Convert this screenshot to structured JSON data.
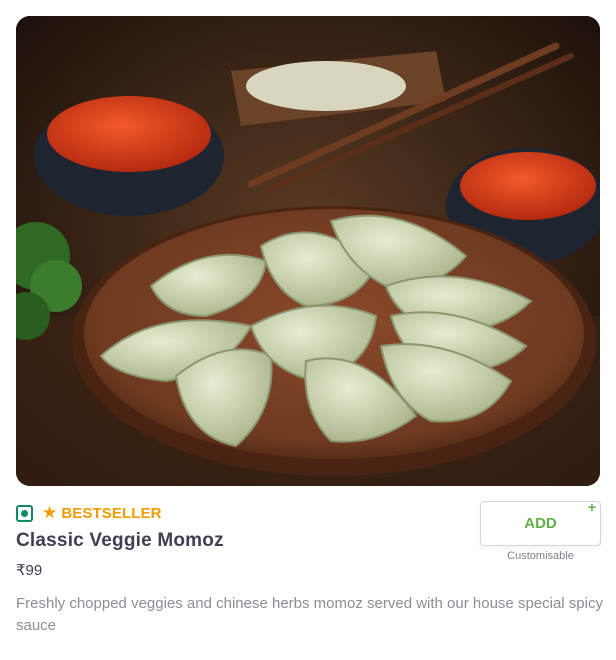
{
  "menu_item": {
    "image_alt": "Plate of veg momos with red chutney and chopsticks",
    "diet_type": "veg",
    "badge_label": "BESTSELLER",
    "name": "Classic Veggie Momoz",
    "price": "₹99",
    "description": "Freshly chopped veggies and chinese herbs momoz served with our house special spicy sauce",
    "add_button": {
      "label": "ADD",
      "plus": "+",
      "note": "Customisable"
    }
  },
  "colors": {
    "veg_green": "#0f8a65",
    "bestseller_orange": "#ee9c00",
    "add_green": "#60b246",
    "text_dark": "#3d4152",
    "text_muted": "#8b8d97"
  },
  "icons": {
    "veg_indicator": "veg-indicator-icon",
    "bestseller_star": "star-icon"
  }
}
